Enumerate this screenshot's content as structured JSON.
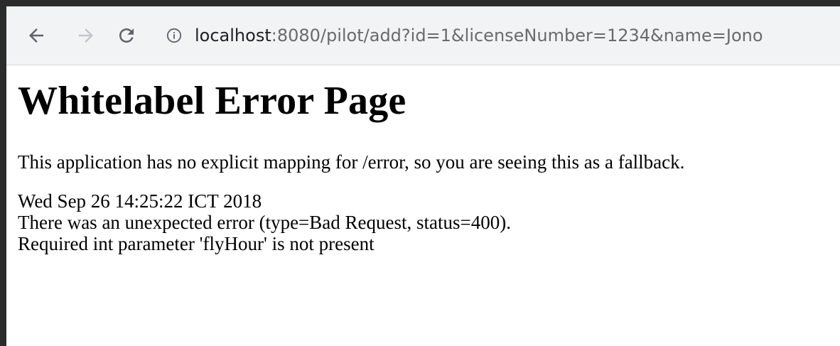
{
  "browser": {
    "url": {
      "host": "localhost",
      "rest": ":8080/pilot/add?id=1&licenseNumber=1234&name=Jono"
    },
    "icons": {
      "back": "arrow-back-icon",
      "forward": "arrow-forward-icon",
      "reload": "reload-icon",
      "site_info": "info-icon"
    }
  },
  "page": {
    "title": "Whitelabel Error Page",
    "explanation": "This application has no explicit mapping for /error, so you are seeing this as a fallback.",
    "timestamp": "Wed Sep 26 14:25:22 ICT 2018",
    "error_line": "There was an unexpected error (type=Bad Request, status=400).",
    "message": "Required int parameter 'flyHour' is not present"
  },
  "colors": {
    "toolbar_bg": "#f1f3f4",
    "url_host": "#202124",
    "url_rest": "#6a6a6a",
    "icon_enabled": "#5f6368",
    "icon_disabled": "#c3c6c9"
  }
}
